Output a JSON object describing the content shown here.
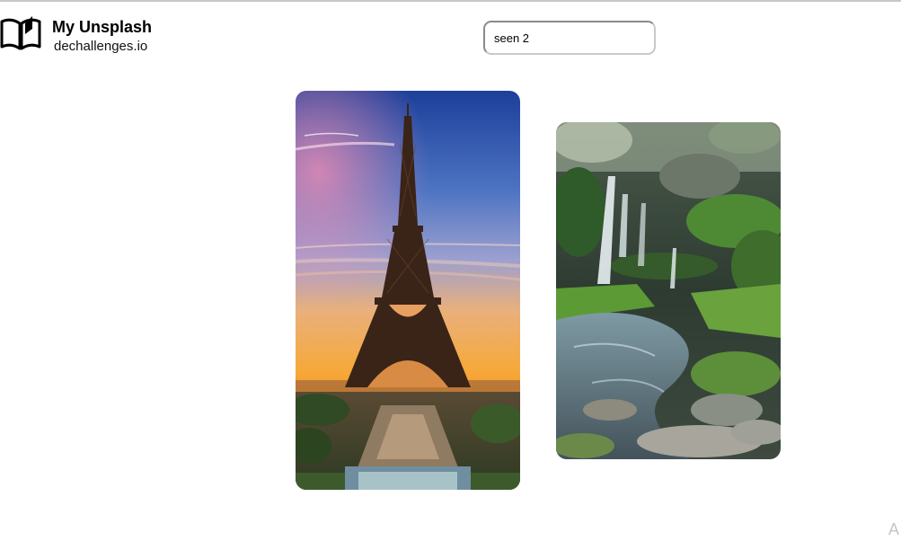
{
  "header": {
    "title": "My Unsplash",
    "subtitle": "dechallenges.io",
    "logo_icon": "open-book-icon"
  },
  "search": {
    "value": "seen 2"
  },
  "gallery": {
    "images": [
      {
        "subject": "eiffel-tower-sunset"
      },
      {
        "subject": "mossy-waterfall"
      }
    ]
  },
  "corner": {
    "letter": "A"
  }
}
